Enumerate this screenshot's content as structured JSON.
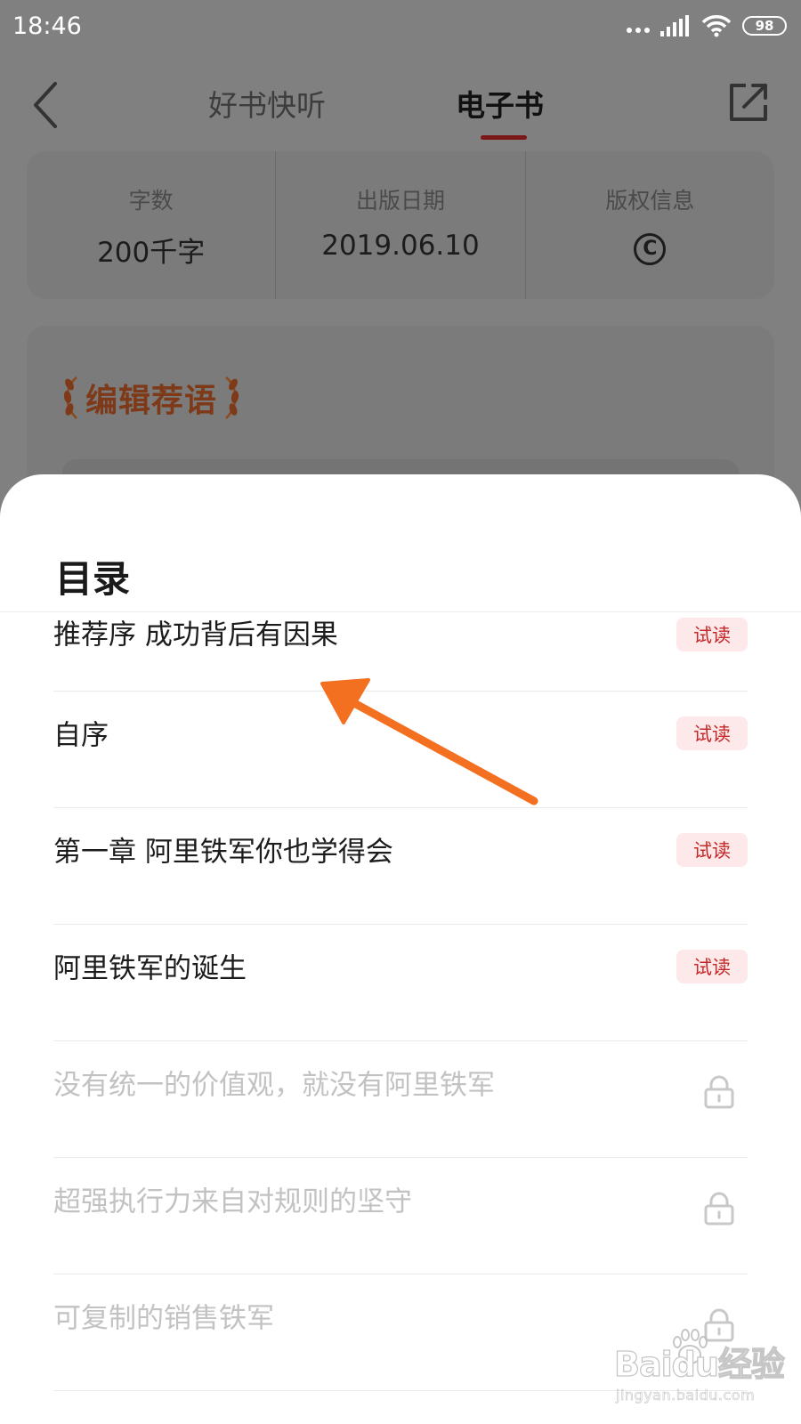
{
  "status_bar": {
    "time": "18:46",
    "battery": "98"
  },
  "header": {
    "tabs": [
      {
        "label": "好书快听",
        "active": false
      },
      {
        "label": "电子书",
        "active": true
      }
    ]
  },
  "book_info": [
    {
      "label": "字数",
      "value": "200千字"
    },
    {
      "label": "出版日期",
      "value": "2019.06.10"
    },
    {
      "label": "版权信息",
      "value": "©"
    }
  ],
  "editor_section": {
    "title": "编辑荐语"
  },
  "toc": {
    "title": "目录",
    "items": [
      {
        "title": "推荐序 成功背后有因果",
        "status": "trial",
        "badge": "试读"
      },
      {
        "title": "自序",
        "status": "trial",
        "badge": "试读"
      },
      {
        "title": "第一章 阿里铁军你也学得会",
        "status": "trial",
        "badge": "试读"
      },
      {
        "title": "阿里铁军的诞生",
        "status": "trial",
        "badge": "试读"
      },
      {
        "title": "没有统一的价值观，就没有阿里铁军",
        "status": "locked",
        "icon": "lock-icon"
      },
      {
        "title": "超强执行力来自对规则的坚守",
        "status": "locked",
        "icon": "lock-icon"
      },
      {
        "title": "可复制的销售铁军",
        "status": "locked",
        "icon": "lock-icon"
      }
    ]
  },
  "watermark": {
    "logo": "Baidu经验",
    "url": "jingyan.baidu.com"
  },
  "colors": {
    "accent": "#c62828",
    "badge_bg": "#fde9e9",
    "annotation_arrow": "#f37021",
    "locked_text": "#c2c2c2",
    "overlay": "#808080"
  }
}
